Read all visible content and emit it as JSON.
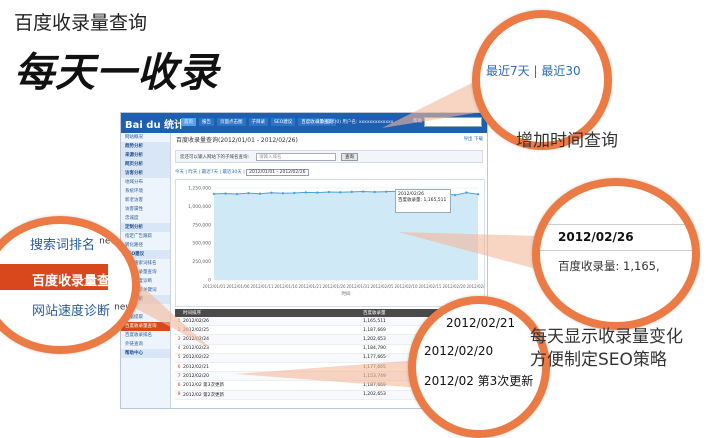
{
  "promo": {
    "subtitle": "百度收录量查询",
    "title": "每天一收录",
    "caption_time": "增加时间查询",
    "caption_daily_line1": "每天显示收录量变化",
    "caption_daily_line2": "方便制定SEO策略"
  },
  "app": {
    "logo": "Bai du 统计",
    "tabs": [
      "首页",
      "报告",
      "页面点击图",
      "子目录",
      "SEO建议",
      "百度收录量查询"
    ],
    "user": "1.0 提示(0) 用户名: xxxxxxxxxxxxx",
    "help": "帮助",
    "search_placeholder": "",
    "sidebar": [
      {
        "label": "网站概况",
        "type": "item"
      },
      {
        "label": "趋势分析",
        "type": "group"
      },
      {
        "label": "来源分析",
        "type": "group"
      },
      {
        "label": "网页分析",
        "type": "group"
      },
      {
        "label": "访客分析",
        "type": "group"
      },
      {
        "label": "地域分布",
        "type": "item"
      },
      {
        "label": "系统环境",
        "type": "item"
      },
      {
        "label": "新老访客",
        "type": "item"
      },
      {
        "label": "访客属性",
        "type": "item"
      },
      {
        "label": "忠诚度",
        "type": "item"
      },
      {
        "label": "定制分析",
        "type": "group"
      },
      {
        "label": "指定广告跟踪",
        "type": "item"
      },
      {
        "label": "转化路径",
        "type": "item"
      },
      {
        "label": "SEO建议",
        "type": "group"
      },
      {
        "label": "百度搜索词排名",
        "type": "item"
      },
      {
        "label": "百度收录量查询",
        "type": "item"
      },
      {
        "label": "网站速度诊断",
        "type": "item"
      },
      {
        "label": "搜索引擎关键词",
        "type": "item"
      },
      {
        "label": "优化分析",
        "type": "group"
      },
      {
        "label": "设置",
        "type": "item"
      },
      {
        "label": "数据提取",
        "type": "item"
      },
      {
        "label": "百度收录量查询",
        "type": "active"
      },
      {
        "label": "百度收录排名",
        "type": "item"
      },
      {
        "label": "外链查询",
        "type": "item"
      },
      {
        "label": "帮助中心",
        "type": "group"
      }
    ],
    "main_title": "百度收录量查询(2012/01/01 - 2012/02/26)",
    "actions": "导出   下载",
    "query_label": "您还可以输入网站下的子域名查询:",
    "query_placeholder": "请输入域名",
    "query_button": "查询",
    "time_links": [
      "今天",
      "昨天",
      "最近7天",
      "最近30天"
    ],
    "date_range": "2012/01/01 - 2012/02/26",
    "tooltip_date": "2012/02/26",
    "tooltip_text": "百度收录量: 1,165,511",
    "table_headers": [
      "",
      "时间排序",
      "百度收录量",
      "变化"
    ],
    "table_rows": [
      {
        "i": "1",
        "date": "2012/02/26",
        "value": "1,165,511",
        "op": ""
      },
      {
        "i": "2",
        "date": "2012/02/25",
        "value": "1,187,669",
        "op": ""
      },
      {
        "i": "3",
        "date": "2012/02/24",
        "value": "1,202,653",
        "op": ""
      },
      {
        "i": "4",
        "date": "2012/02/23",
        "value": "1,184,790",
        "op": ""
      },
      {
        "i": "5",
        "date": "2012/02/22",
        "value": "1,177,665",
        "op": ""
      },
      {
        "i": "6",
        "date": "2012/02/21",
        "value": "1,177,665",
        "op": ""
      },
      {
        "i": "7",
        "date": "2012/02/20",
        "value": "1,153,749",
        "op": ""
      },
      {
        "i": "8",
        "date": "2012/02 第3次更新",
        "value": "1,187,669",
        "op": ""
      },
      {
        "i": "9",
        "date": "2012/02 第2次更新",
        "value": "1,202,653",
        "op": ""
      }
    ]
  },
  "callouts": {
    "time_links": [
      "最近7天",
      "|",
      "最近30"
    ],
    "sidebar_items": [
      "搜索词排名",
      "百度收录量查询",
      "网站速度诊断"
    ],
    "new_badge": "new",
    "tooltip_date": "2012/02/26",
    "tooltip_text": "百度收录量: 1,165,",
    "dates": [
      "2012/02/21",
      "2012/02/20",
      "2012/02 第3次更新"
    ]
  },
  "chart_data": {
    "type": "area",
    "ylim": [
      0,
      1250000
    ],
    "yticks": [
      "1,250,000",
      "1,000,000",
      "750,000",
      "500,000",
      "250,000",
      "0"
    ],
    "xticks": [
      "2012/01/01",
      "2012/01/06",
      "2012/01/11",
      "2012/01/16",
      "2012/01/21",
      "2012/01/26",
      "2012/01/31",
      "2012/02/05",
      "2012/02/10",
      "2012/02/15",
      "2012/02/20",
      "2012/02/25"
    ],
    "x_label": "时间",
    "values": [
      1170000,
      1175000,
      1168000,
      1180000,
      1172000,
      1185000,
      1178000,
      1182000,
      1190000,
      1188000,
      1195000,
      1192000,
      1198000,
      1202000,
      1196000,
      1200000,
      1205000,
      1198000,
      1202653,
      1184790,
      1177665,
      1153749,
      1187669,
      1165511
    ]
  }
}
